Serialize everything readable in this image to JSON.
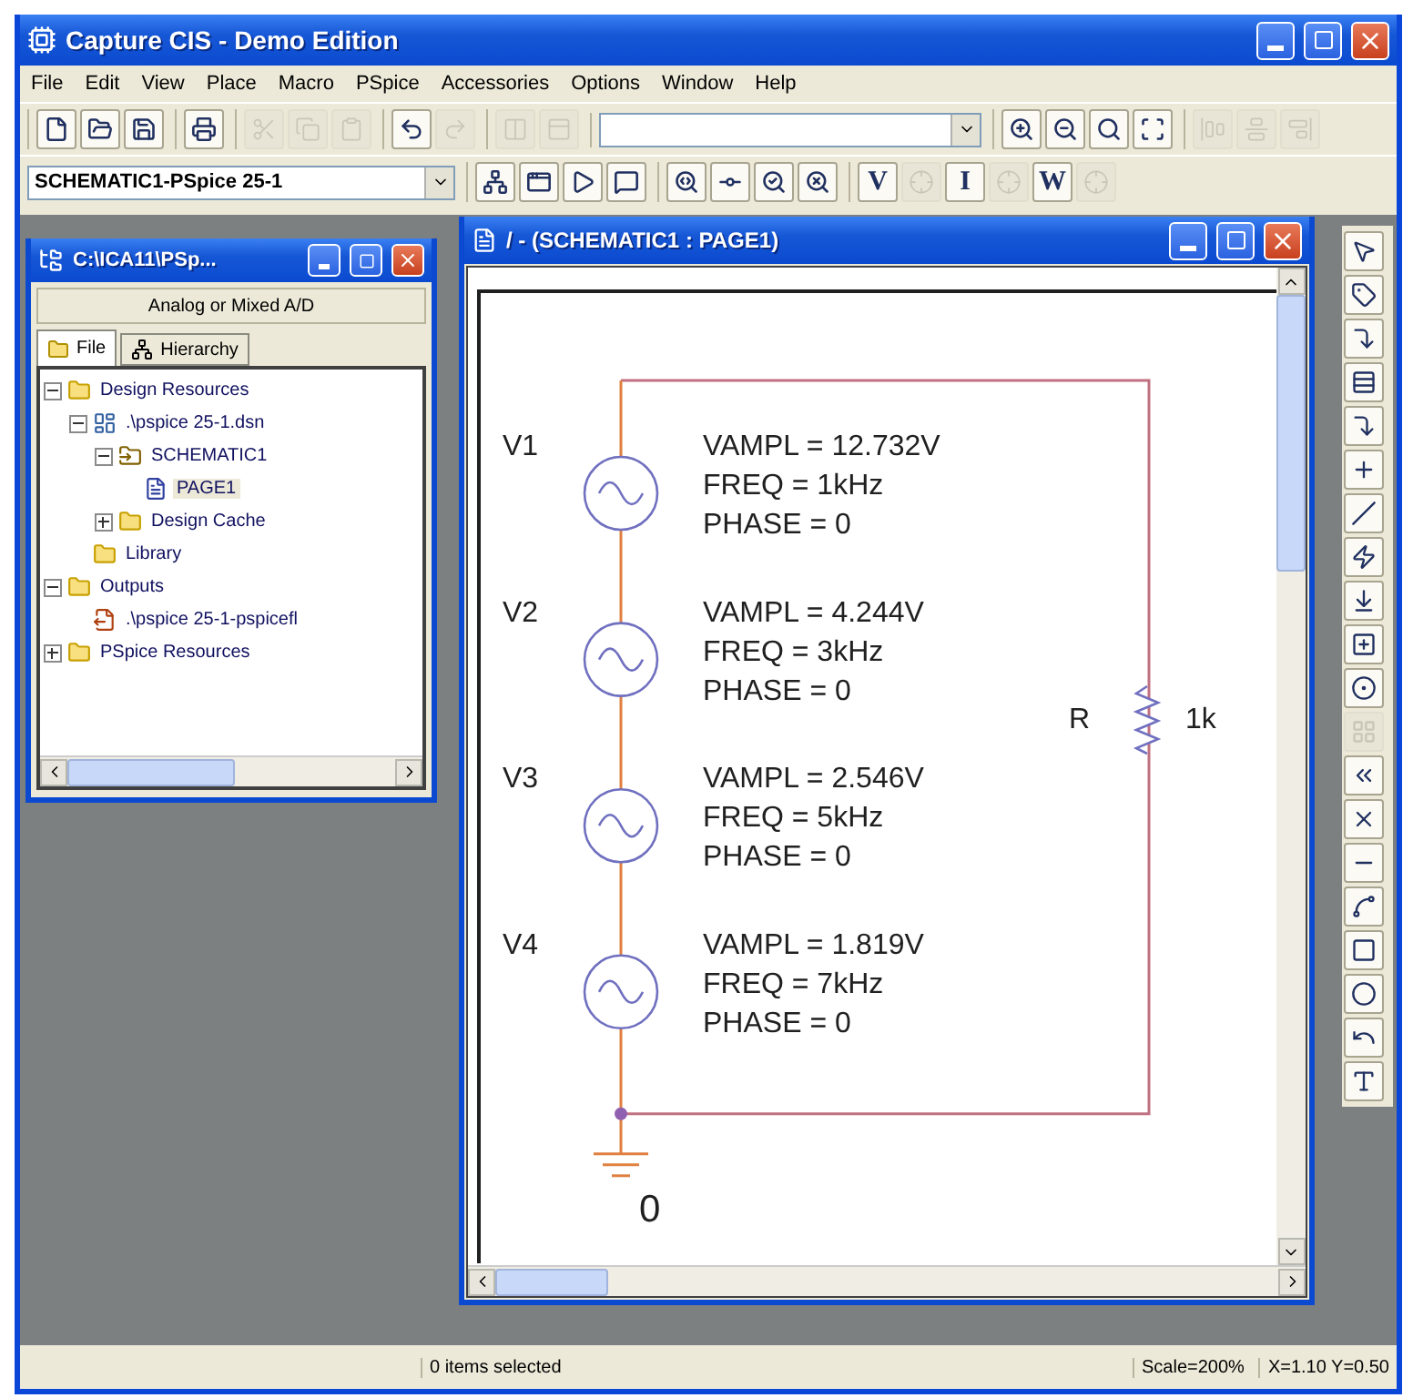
{
  "window": {
    "title": "Capture CIS - Demo Edition"
  },
  "menu": [
    "File",
    "Edit",
    "View",
    "Place",
    "Macro",
    "PSpice",
    "Accessories",
    "Options",
    "Window",
    "Help"
  ],
  "toolbar": {
    "groups": [
      [
        {
          "kind": "new",
          "disabled": false
        },
        {
          "kind": "open",
          "disabled": false
        },
        {
          "kind": "save",
          "disabled": false
        }
      ],
      [
        {
          "kind": "print",
          "disabled": false
        }
      ],
      [
        {
          "kind": "cut",
          "disabled": true
        },
        {
          "kind": "copy",
          "disabled": true
        },
        {
          "kind": "paste",
          "disabled": true
        }
      ],
      [
        {
          "kind": "undo",
          "disabled": false
        },
        {
          "kind": "redo",
          "disabled": true
        }
      ],
      [
        {
          "kind": "columns",
          "disabled": true
        },
        {
          "kind": "panel",
          "disabled": true
        }
      ],
      [
        {
          "kind": "combo"
        }
      ],
      [
        {
          "kind": "zoom-in",
          "disabled": false
        },
        {
          "kind": "zoom-out",
          "disabled": false
        },
        {
          "kind": "search",
          "disabled": false
        },
        {
          "kind": "zoom-all",
          "disabled": false
        }
      ],
      [
        {
          "kind": "align-a",
          "disabled": true
        },
        {
          "kind": "align-b",
          "disabled": true
        },
        {
          "kind": "align-c",
          "disabled": true
        }
      ]
    ]
  },
  "toolbar2": {
    "combo": "SCHEMATIC1-PSpice 25-1",
    "groups": [
      [
        {
          "kind": "hierarchy",
          "disabled": false
        },
        {
          "kind": "window",
          "disabled": false
        },
        {
          "kind": "run",
          "disabled": false
        },
        {
          "kind": "message",
          "disabled": false
        }
      ],
      [
        {
          "kind": "probe",
          "disabled": false
        },
        {
          "kind": "probe2",
          "disabled": false
        },
        {
          "kind": "probe3",
          "disabled": false
        },
        {
          "kind": "probe4",
          "disabled": false
        }
      ],
      [
        {
          "kind": "letter",
          "label": "V",
          "disabled": false
        },
        {
          "kind": "marker",
          "disabled": true
        },
        {
          "kind": "letter",
          "label": "I",
          "disabled": false
        },
        {
          "kind": "marker",
          "disabled": true
        },
        {
          "kind": "letter",
          "label": "W",
          "disabled": false
        },
        {
          "kind": "marker",
          "disabled": true
        }
      ]
    ]
  },
  "project_window": {
    "title": "C:\\ICA11\\PSp...",
    "subtitle": "Analog or Mixed A/D",
    "tabs": [
      {
        "label": "File",
        "selected": true
      },
      {
        "label": "Hierarchy",
        "selected": false
      }
    ],
    "tree": [
      {
        "label": "Design Resources",
        "kind": "folder",
        "expanded": true,
        "selected": false,
        "children": [
          {
            "label": ".\\pspice 25-1.dsn",
            "kind": "design",
            "expanded": true,
            "selected": false,
            "children": [
              {
                "label": "SCHEMATIC1",
                "kind": "schematic",
                "expanded": true,
                "selected": false,
                "children": [
                  {
                    "label": "PAGE1",
                    "kind": "page",
                    "selected": true
                  }
                ]
              },
              {
                "label": "Design Cache",
                "kind": "folder",
                "expanded": false,
                "selected": false
              }
            ]
          },
          {
            "label": "Library",
            "kind": "folder",
            "selected": false
          }
        ]
      },
      {
        "label": "Outputs",
        "kind": "folder",
        "expanded": true,
        "selected": false,
        "children": [
          {
            "label": ".\\pspice 25-1-pspicefl",
            "kind": "output",
            "selected": false
          }
        ]
      },
      {
        "label": "PSpice Resources",
        "kind": "folder",
        "expanded": false,
        "selected": false
      }
    ]
  },
  "schematic_window": {
    "title": "/ - (SCHEMATIC1 : PAGE1)",
    "sources": [
      {
        "name": "V1",
        "params": [
          "VAMPL = 12.732V",
          "FREQ = 1kHz",
          "PHASE = 0"
        ]
      },
      {
        "name": "V2",
        "params": [
          "VAMPL = 4.244V",
          "FREQ = 3kHz",
          "PHASE = 0"
        ]
      },
      {
        "name": "V3",
        "params": [
          "VAMPL = 2.546V",
          "FREQ = 5kHz",
          "PHASE = 0"
        ]
      },
      {
        "name": "V4",
        "params": [
          "VAMPL = 1.819V",
          "FREQ = 7kHz",
          "PHASE = 0"
        ]
      }
    ],
    "resistor": {
      "name": "R",
      "value": "1k"
    },
    "ground": {
      "label": "0"
    }
  },
  "palette": [
    {
      "kind": "pointer"
    },
    {
      "kind": "part"
    },
    {
      "kind": "wire"
    },
    {
      "kind": "net-alias"
    },
    {
      "kind": "bus"
    },
    {
      "kind": "junction"
    },
    {
      "kind": "bus-entry"
    },
    {
      "kind": "power"
    },
    {
      "kind": "ground"
    },
    {
      "kind": "hier-block"
    },
    {
      "kind": "port"
    },
    {
      "kind": "pin",
      "disabled": true
    },
    {
      "kind": "off-page"
    },
    {
      "kind": "no-connect"
    },
    {
      "kind": "line"
    },
    {
      "kind": "polyline"
    },
    {
      "kind": "rectangle"
    },
    {
      "kind": "ellipse"
    },
    {
      "kind": "arc"
    },
    {
      "kind": "text"
    }
  ],
  "status_bar": {
    "message": "0 items selected",
    "scale": "Scale=200%",
    "coords": "X=1.10  Y=0.50"
  }
}
